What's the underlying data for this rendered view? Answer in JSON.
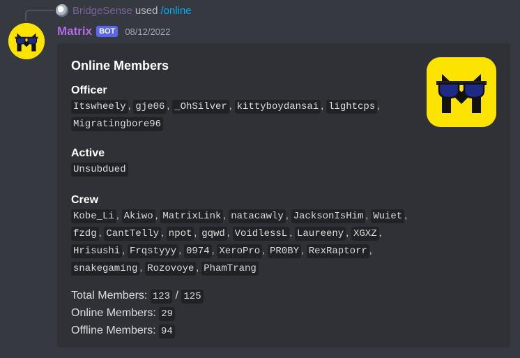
{
  "reply": {
    "username": "BridgeSense",
    "used_text": "used",
    "command": "/online"
  },
  "message": {
    "username": "Matrix",
    "bot_tag": "BOT",
    "timestamp": "08/12/2022",
    "accent_color": "#b06ce3"
  },
  "embed": {
    "title": "Online Members",
    "fields": [
      {
        "name": "Officer",
        "members": [
          "Itswheely",
          "gje06",
          "_OhSilver",
          "kittyboydansai",
          "lightcps",
          "Migratingbore96"
        ]
      },
      {
        "name": "Active",
        "members": [
          "Unsubdued"
        ]
      },
      {
        "name": "Crew",
        "members": [
          "Kobe_Li",
          "Akiwo",
          "MatrixLink",
          "natacawly",
          "JacksonIsHim",
          "Wuiet",
          "fzdg",
          "CantTelly",
          "npot",
          "gqwd",
          "VoidlessL",
          "Laureeny",
          "XGXZ",
          "Hrisushi",
          "Frqstyyy",
          "0974",
          "XeroPro",
          "PR0BY",
          "RexRaptorr",
          "snakegaming",
          "Rozovoye",
          "PhamTrang"
        ]
      }
    ],
    "stats": {
      "total_label": "Total Members:",
      "total_value": "123",
      "total_sep": "/",
      "total_max": "125",
      "online_label": "Online Members:",
      "online_value": "29",
      "offline_label": "Offline Members:",
      "offline_value": "94"
    }
  },
  "colors": {
    "background": "#36393f",
    "embed_bg": "#2f3136",
    "logo_yellow": "#fce300",
    "command_link": "#00aff4",
    "bot_tag": "#5865f2"
  },
  "icons": {
    "avatar": "matrix-logo-icon",
    "thumbnail": "matrix-logo-icon"
  }
}
